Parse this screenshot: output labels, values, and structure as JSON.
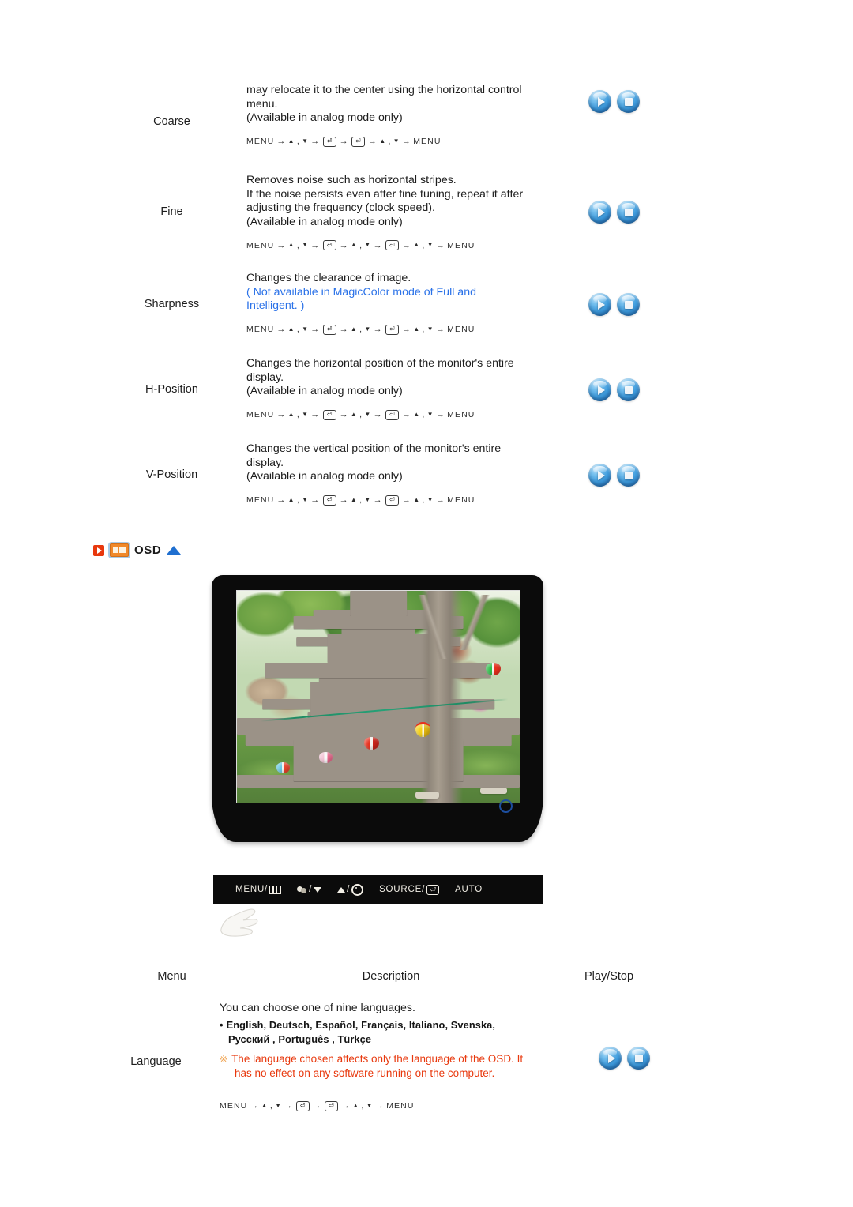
{
  "spec_rows": [
    {
      "label": "Coarse",
      "lines": [
        {
          "text": "may relocate it to the center using the horizontal control",
          "color": "black"
        },
        {
          "text": "menu.",
          "color": "black"
        },
        {
          "text": "(Available in analog mode only)",
          "color": "black"
        }
      ],
      "nav": "MENU → ▲ , ▼ → ⏎ → ⏎ → ▲ , ▼ → MENU",
      "nav_variant": "short"
    },
    {
      "label": "Fine",
      "lines": [
        {
          "text": "Removes noise such as horizontal stripes.",
          "color": "black"
        },
        {
          "text": "If the noise persists even after fine tuning, repeat it after",
          "color": "black"
        },
        {
          "text": "adjusting the frequency (clock speed).",
          "color": "black"
        },
        {
          "text": "(Available in analog mode only)",
          "color": "black"
        }
      ],
      "nav": "MENU → ▲ , ▼ → ⏎ → ▲ , ▼ → ⏎ → ▲ , ▼ → MENU",
      "nav_variant": "long"
    },
    {
      "label": "Sharpness",
      "lines": [
        {
          "text": "Changes the clearance of image.",
          "color": "black"
        },
        {
          "text": "( Not available in MagicColor mode of Full and",
          "color": "blue"
        },
        {
          "text": "Intelligent. )",
          "color": "blue"
        }
      ],
      "nav": "MENU → ▲ , ▼ → ⏎ → ▲ , ▼ → ⏎ → ▲ , ▼ → MENU",
      "nav_variant": "long"
    },
    {
      "label": "H-Position",
      "lines": [
        {
          "text": "Changes the horizontal position of the monitor's entire",
          "color": "black"
        },
        {
          "text": "display.",
          "color": "black"
        },
        {
          "text": "(Available in analog mode only)",
          "color": "black"
        }
      ],
      "nav": "MENU → ▲ , ▼ → ⏎ → ▲ , ▼ → ⏎ → ▲ , ▼ → MENU",
      "nav_variant": "long"
    },
    {
      "label": "V-Position",
      "lines": [
        {
          "text": "Changes the vertical position of the monitor's entire",
          "color": "black"
        },
        {
          "text": "display.",
          "color": "black"
        },
        {
          "text": "(Available in analog mode only)",
          "color": "black"
        }
      ],
      "nav": "MENU → ▲ , ▼ → ⏎ → ▲ , ▼ → ⏎ → ▲ , ▼ → MENU",
      "nav_variant": "long"
    }
  ],
  "osd_section": {
    "title": "OSD",
    "play_icon": "play-square-icon",
    "monitor_icon": "monitor-icon",
    "top_arrow_icon": "triangle-up-icon"
  },
  "monitor_illustration": {
    "screen_alt": "garden photo with stone pagoda, trees and paper lanterns",
    "power_led": "power-indicator-ring"
  },
  "control_panel": {
    "items": [
      {
        "label": "MENU/",
        "glyph": "menu-grid-icon"
      },
      {
        "label": "/",
        "glyph_left": "magiccolor-icon",
        "glyph_right": "triangle-down-icon"
      },
      {
        "label": "/",
        "glyph_left": "triangle-up-icon",
        "glyph_right": "brightness-sun-icon"
      },
      {
        "label": "SOURCE/",
        "glyph": "enter-key-icon"
      },
      {
        "label": "AUTO",
        "glyph": ""
      }
    ],
    "hand_pointer": "hand-pointer-icon"
  },
  "table": {
    "headers": {
      "menu": "Menu",
      "description": "Description",
      "play_stop": "Play/Stop"
    },
    "rows": [
      {
        "label": "Language",
        "intro": "You can choose one of nine languages.",
        "bullet_line1": "English, Deutsch, Español, Français,  Italiano, Svenska,",
        "bullet_line2": "Русский , Português , Türkçe",
        "warning_line1": "The language chosen affects only the language of the OSD. It",
        "warning_line2": "has no effect on any software running on the computer.",
        "warning_mark": "※",
        "nav": "MENU → ▲ , ▼ → ⏎ → ⏎ → ▲ , ▼ → MENU",
        "nav_variant": "short"
      }
    ]
  },
  "buttons": {
    "play_label": "Play",
    "stop_label": "Stop"
  },
  "colors": {
    "link_blue": "#2b72e8",
    "warning_red": "#e8380d",
    "warning_mark_orange": "#f0a24e",
    "accent_blue": "#1f6fd0",
    "icon_orange": "#f0892a",
    "icon_red": "#e8380d",
    "panel_black": "#0b0b0b",
    "text": "#1d1d1d"
  }
}
